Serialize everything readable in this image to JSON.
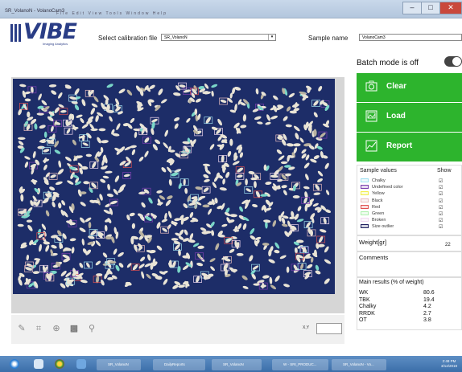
{
  "window": {
    "title": "SR_VolanoN - VolanoCam3",
    "menu_text": "File   Edit   View   Tools   Window   Help"
  },
  "logo": {
    "text": "VIBE",
    "tagline": "Imaging Analytics"
  },
  "header": {
    "calibration_label": "Select calibration file",
    "calibration_value": "SR_VolanoN",
    "sample_label": "Sample name",
    "sample_value": "VolanoCam3"
  },
  "batch": {
    "label": "Batch mode is off",
    "on": false
  },
  "buttons": {
    "clear": "Clear",
    "load": "Load",
    "report": "Report"
  },
  "colors": {
    "green": "#2db42d",
    "image_bg": "#1d2d68"
  },
  "sample_values": {
    "header": "Sample values",
    "show_header": "Show",
    "items": [
      {
        "label": "Chalky",
        "color": "#9fe0f0",
        "checked": true
      },
      {
        "label": "Undefined color",
        "color": "#7b3fb0",
        "checked": true
      },
      {
        "label": "Yellow",
        "color": "#f2ee4a",
        "checked": true
      },
      {
        "label": "Black",
        "color": "#e8bdbd",
        "checked": true
      },
      {
        "label": "Red",
        "color": "#e05050",
        "checked": true
      },
      {
        "label": "Green",
        "color": "#aef0ae",
        "checked": true
      },
      {
        "label": "Broken",
        "color": "#f0d8f0",
        "checked": true
      },
      {
        "label": "Size outlier",
        "color": "#202060",
        "checked": true
      }
    ]
  },
  "weight": {
    "label": "Weight[gr]",
    "value": "22"
  },
  "comments": {
    "label": "Comments",
    "value": ""
  },
  "main_results": {
    "header": "Main results (% of weight)",
    "rows": [
      {
        "name": "WK",
        "value": "80.6"
      },
      {
        "name": "TBK",
        "value": "19.4"
      },
      {
        "name": "Chalky",
        "value": "4.2"
      },
      {
        "name": "RRDK",
        "value": "2.7"
      },
      {
        "name": "OT",
        "value": "3.8"
      }
    ]
  },
  "image_tools": {
    "zoom_label": "X,Y",
    "icons": [
      "pencil-icon",
      "crop-icon",
      "zoom-icon",
      "grid-icon",
      "wrench-icon"
    ]
  },
  "taskbar": {
    "items": [
      "SR_VolanoN",
      "DailyReports",
      "SR_VolanoN",
      "W - SRI_PRODUC...",
      "SR_VolanoN - Vo..."
    ],
    "clock_time": "2:48 PM",
    "clock_date": "3/12/2019"
  }
}
